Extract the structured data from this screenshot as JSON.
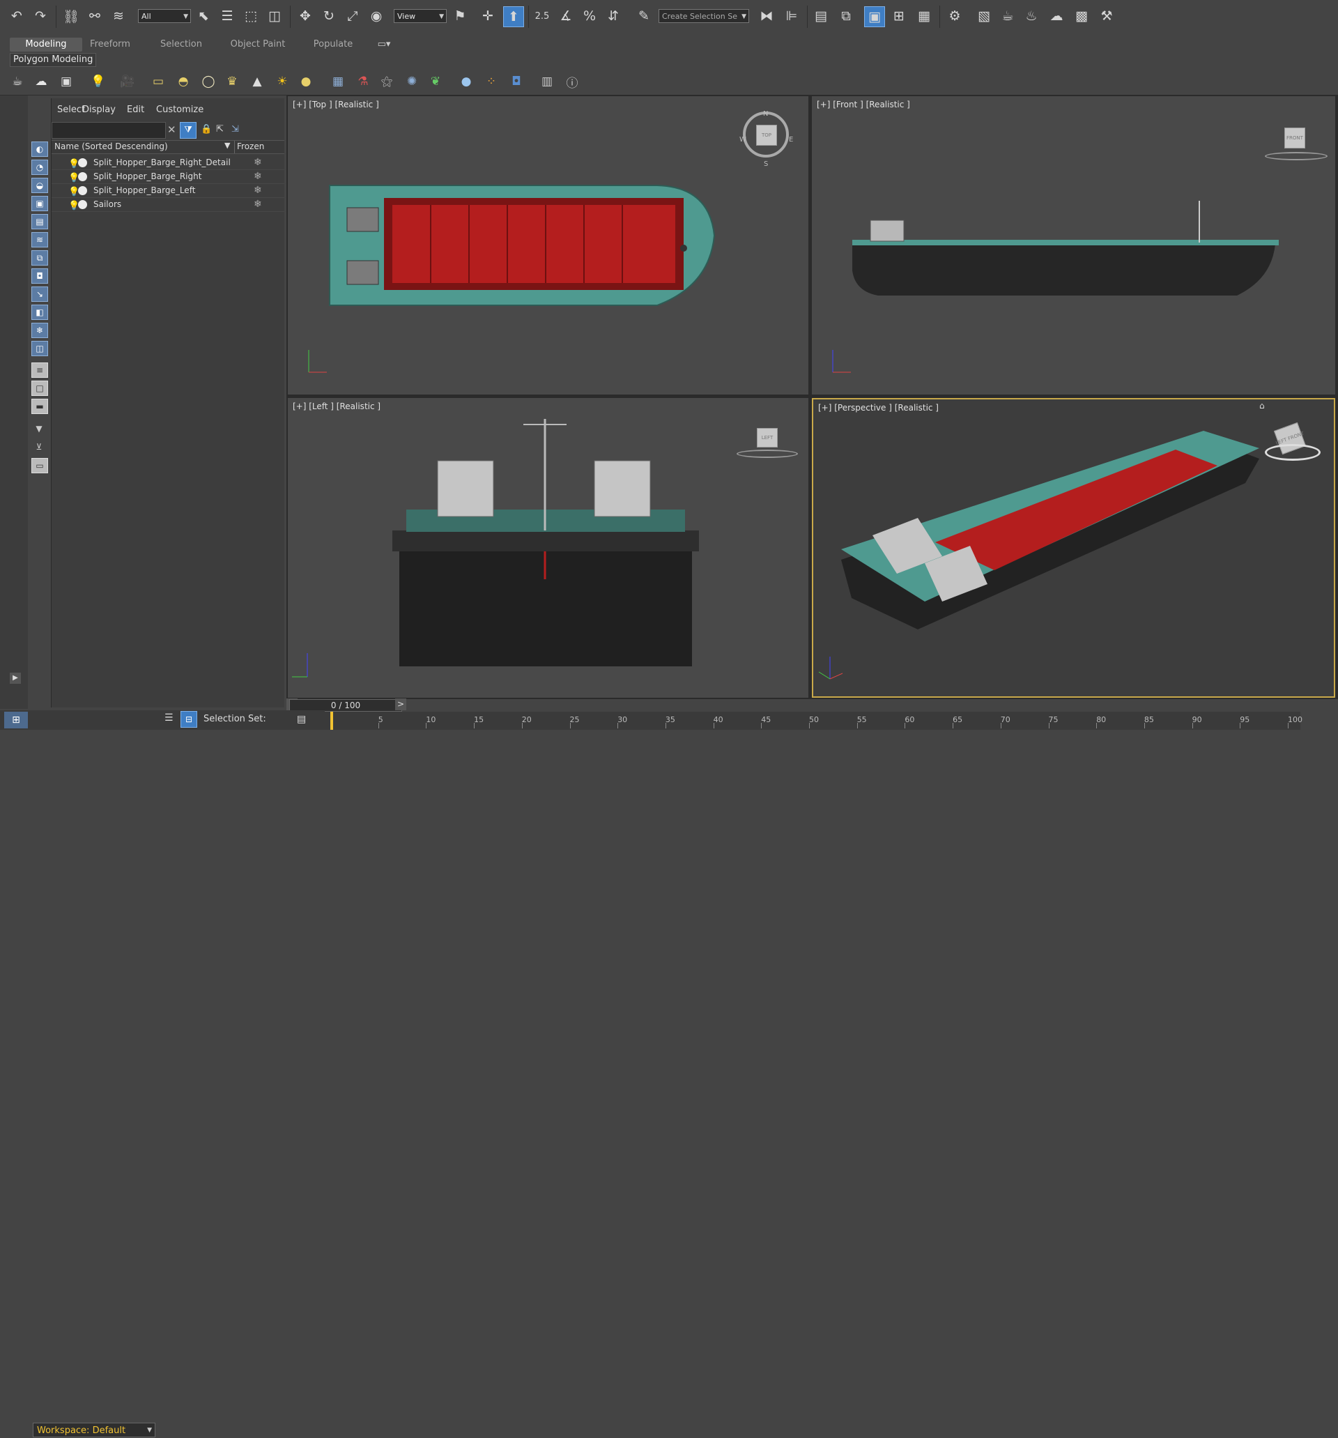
{
  "toolbar": {
    "filter_value": "All",
    "ref_coord_value": "View",
    "selection_set_placeholder": "Create Selection Se",
    "snap_angle_text": "2.5",
    "icons": [
      "undo-icon",
      "redo-icon",
      "link-icon",
      "unlink-icon",
      "bind-space-warp-icon",
      "select-object-icon",
      "select-by-name-icon",
      "rect-region-icon",
      "window-crossing-icon",
      "move-icon",
      "rotate-icon",
      "scale-icon",
      "place-icon",
      "pivot-icon",
      "manipulate-icon",
      "keyboard-shortcut-icon",
      "snap-icon",
      "angle-snap-icon",
      "percent-snap-icon",
      "spinner-snap-icon",
      "edit-named-sets-icon",
      "mirror-icon",
      "align-icon",
      "layer-explorer-icon",
      "toggle-ribbon-icon",
      "curve-editor-icon",
      "schematic-view-icon",
      "material-editor-icon",
      "render-setup-icon",
      "rendered-frame-icon",
      "render-icon",
      "render-production-icon",
      "render-online-icon",
      "hammer-icon"
    ]
  },
  "ribbon": {
    "tabs": [
      "Modeling",
      "Freeform",
      "Selection",
      "Object Paint",
      "Populate"
    ],
    "active_tab": "Modeling",
    "sub_panel": "Polygon Modeling"
  },
  "scene_explorer": {
    "menu": [
      "Select",
      "Display",
      "Edit",
      "Customize"
    ],
    "column_name": "Name (Sorted Descending)",
    "column_frozen": "Frozen",
    "rows": [
      {
        "name": "Split_Hopper_Barge_Right_Detail"
      },
      {
        "name": "Split_Hopper_Barge_Right"
      },
      {
        "name": "Split_Hopper_Barge_Left"
      },
      {
        "name": "Sailors"
      }
    ]
  },
  "viewports": {
    "top_label": "[+] [Top ] [Realistic ]",
    "front_label": "[+] [Front ] [Realistic ]",
    "left_label": "[+] [Left ] [Realistic ]",
    "perspective_label": "[+] [Perspective ] [Realistic ]",
    "compass": {
      "n": "N",
      "s": "S",
      "e": "E",
      "w": "W"
    },
    "cube_top": "TOP",
    "cube_front": "FRONT",
    "cube_left": "LEFT",
    "cube_persp_a": "LEFT",
    "cube_persp_b": "FRONT"
  },
  "timeline": {
    "frame_text": "0 / 100",
    "ticks": [
      "0",
      "5",
      "10",
      "15",
      "20",
      "25",
      "30",
      "35",
      "40",
      "45",
      "50",
      "55",
      "60",
      "65",
      "70",
      "75",
      "80",
      "85",
      "90",
      "95",
      "100"
    ]
  },
  "status": {
    "workspace": "Workspace: Default",
    "selection_set": "Selection Set:"
  },
  "colors": {
    "hull_teal": "#4f9a90",
    "hopper_red": "#b41e1e",
    "hull_dark": "#222222",
    "accent_yellow": "#f0c232",
    "active_blue": "#3f7ec4"
  }
}
